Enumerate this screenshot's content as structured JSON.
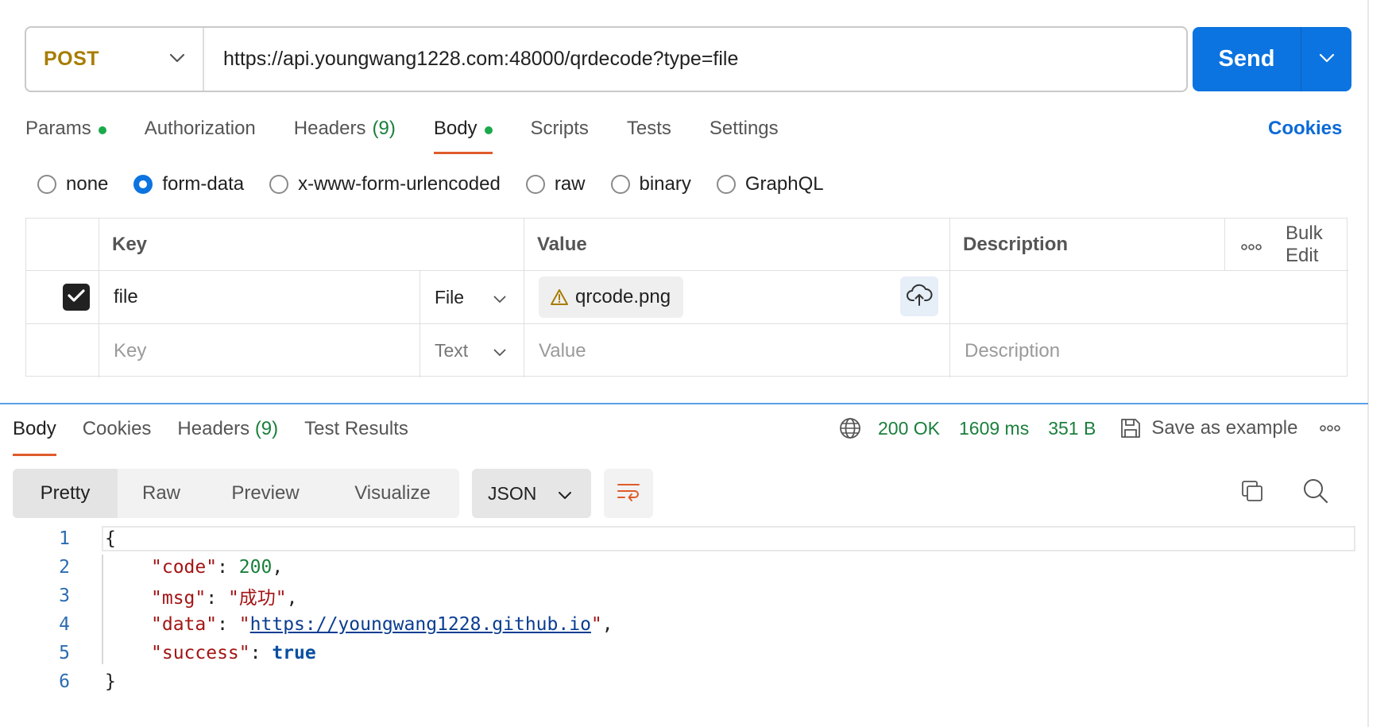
{
  "request": {
    "method": "POST",
    "url": "https://api.youngwang1228.com:48000/qrdecode?type=file",
    "send_label": "Send"
  },
  "request_tabs": [
    {
      "label": "Params",
      "dot": true
    },
    {
      "label": "Authorization"
    },
    {
      "label": "Headers",
      "count": "(9)"
    },
    {
      "label": "Body",
      "dot": true,
      "active": true
    },
    {
      "label": "Scripts"
    },
    {
      "label": "Tests"
    },
    {
      "label": "Settings"
    }
  ],
  "cookies_link": "Cookies",
  "body_types": [
    {
      "label": "none",
      "checked": false
    },
    {
      "label": "form-data",
      "checked": true
    },
    {
      "label": "x-www-form-urlencoded",
      "checked": false
    },
    {
      "label": "raw",
      "checked": false
    },
    {
      "label": "binary",
      "checked": false
    },
    {
      "label": "GraphQL",
      "checked": false
    }
  ],
  "form_table": {
    "headers": {
      "key": "Key",
      "value": "Value",
      "description": "Description",
      "bulk_edit": "Bulk Edit"
    },
    "rows": [
      {
        "checked": true,
        "key": "file",
        "type": "File",
        "value": "qrcode.png",
        "description": ""
      }
    ],
    "empty_row": {
      "key_placeholder": "Key",
      "type": "Text",
      "value_placeholder": "Value",
      "description_placeholder": "Description"
    }
  },
  "response": {
    "tabs": [
      {
        "label": "Body",
        "active": true
      },
      {
        "label": "Cookies"
      },
      {
        "label": "Headers",
        "count": "(9)"
      },
      {
        "label": "Test Results"
      }
    ],
    "status": "200 OK",
    "time": "1609 ms",
    "size": "351 B",
    "save_label": "Save as example",
    "formats": [
      "Pretty",
      "Raw",
      "Preview",
      "Visualize"
    ],
    "active_format": "Pretty",
    "language": "JSON",
    "code": {
      "line_numbers": [
        "1",
        "2",
        "3",
        "4",
        "5",
        "6"
      ],
      "open_brace": "{",
      "close_brace": "}",
      "entries": [
        {
          "key": "\"code\"",
          "value": "200",
          "value_type": "number"
        },
        {
          "key": "\"msg\"",
          "value": "\"成功\"",
          "value_type": "string"
        },
        {
          "key": "\"data\"",
          "value": "https://youngwang1228.github.io",
          "value_type": "url"
        },
        {
          "key": "\"success\"",
          "value": "true",
          "value_type": "bool"
        }
      ]
    }
  },
  "colors": {
    "method": "#a77c00",
    "send": "#0b74e0",
    "active_tab_underline": "#e05b2c",
    "dot": "#1ba94c",
    "status_green": "#1a7f3c"
  },
  "icons": [
    "chevron-down-icon",
    "checkbox-check-icon",
    "warning-icon",
    "cloud-upload-icon",
    "more-horizontal-icon",
    "globe-icon",
    "save-icon",
    "wrap-lines-icon",
    "copy-icon",
    "search-icon"
  ]
}
